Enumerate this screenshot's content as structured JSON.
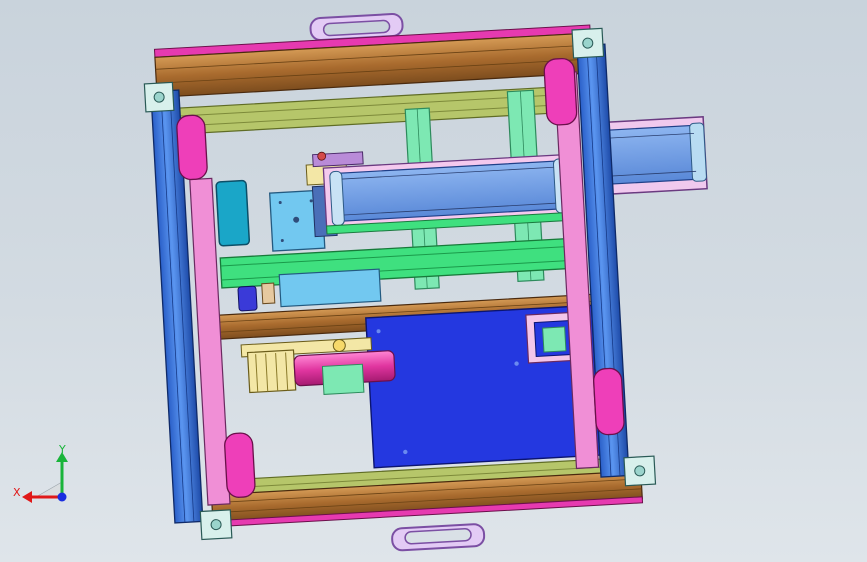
{
  "viewport": {
    "background_top": "#c9d3dc",
    "background_bottom": "#dfe5ea"
  },
  "model": {
    "colors": {
      "frame_blue": "#3a79e0",
      "frame_wood": "#b57a3a",
      "olive": "#b6c66a",
      "magenta": "#ee3fb9",
      "pink_rail": "#f08fd6",
      "mint": "#7de8b3",
      "green_bar": "#3fe07f",
      "conveyor_blue": "#6c9de8",
      "plate_blue": "#2438e0",
      "teal": "#1aa6c8",
      "sky": "#72c8f0",
      "lavender": "#d7b8f2",
      "cream": "#f3e7a6",
      "corner_cap": "#d8f0ec"
    }
  },
  "triad": {
    "x_label": "X",
    "y_label": "Y",
    "x_color": "#e01818",
    "y_color": "#19b43a",
    "z_color": "#1a2ee0"
  }
}
